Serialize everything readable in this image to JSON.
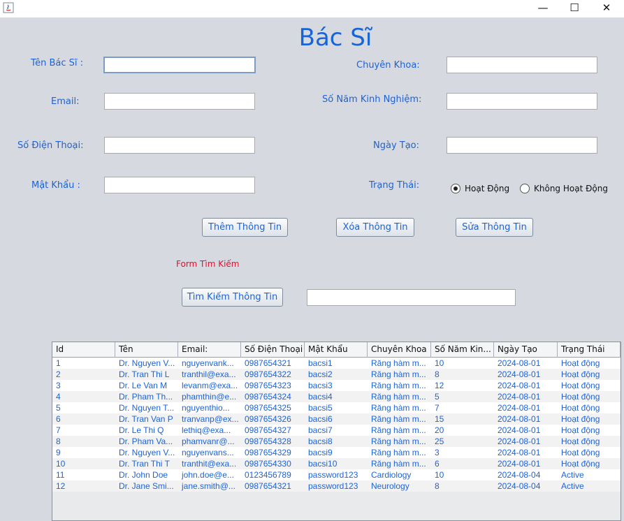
{
  "window": {
    "minimize": "—",
    "maximize": "☐",
    "close": "✕"
  },
  "heading": "Bác Sĩ",
  "labels": {
    "name": "Tên Bác Sĩ :",
    "email": "Email:",
    "phone": "Số Điện Thoại:",
    "password": "Mật Khẩu :",
    "specialty": "Chuyên Khoa:",
    "experience": "Số Năm Kinh Nghiệm:",
    "created": "Ngày Tạo:",
    "status": "Trạng Thái:"
  },
  "fields": {
    "name": "",
    "email": "",
    "phone": "",
    "password": "",
    "specialty": "",
    "experience": "",
    "created": "",
    "search": ""
  },
  "radios": {
    "active": "Hoạt Động",
    "inactive": "Không Hoạt Động",
    "selected": "active"
  },
  "buttons": {
    "add": "Thêm Thông Tin",
    "delete": "Xóa Thông Tin",
    "edit": "Sửa Thông Tin",
    "search": "Tìm Kiếm Thông Tin"
  },
  "search_form_label": "Form Tìm Kiếm",
  "table": {
    "headers": [
      "Id",
      "Tên",
      "Email:",
      "Số Điện Thoại",
      "Mật Khẩu",
      "Chuyên Khoa",
      "Số Năm Kin...",
      "Ngày Tạo",
      "Trạng Thái"
    ],
    "rows": [
      [
        "1",
        "Dr. Nguyen V...",
        "nguyenvank...",
        "0987654321",
        "bacsi1",
        "Răng hàm m...",
        "10",
        "2024-08-01",
        "Hoạt động"
      ],
      [
        "2",
        "Dr. Tran Thi L",
        "tranthil@exa...",
        "0987654322",
        "bacsi2",
        "Răng hàm m...",
        "8",
        "2024-08-01",
        "Hoạt động"
      ],
      [
        "3",
        "Dr. Le Van M",
        "levanm@exa...",
        "0987654323",
        "bacsi3",
        "Răng hàm m...",
        "12",
        "2024-08-01",
        "Hoạt động"
      ],
      [
        "4",
        "Dr. Pham Th...",
        "phamthin@e...",
        "0987654324",
        "bacsi4",
        "Răng hàm m...",
        "5",
        "2024-08-01",
        "Hoạt động"
      ],
      [
        "5",
        "Dr. Nguyen T...",
        "nguyenthio...",
        "0987654325",
        "bacsi5",
        "Răng hàm m...",
        "7",
        "2024-08-01",
        "Hoạt động"
      ],
      [
        "6",
        "Dr. Tran Van P",
        "tranvanp@ex...",
        "0987654326",
        "bacsi6",
        "Răng hàm m...",
        "15",
        "2024-08-01",
        "Hoạt động"
      ],
      [
        "7",
        "Dr. Le Thi Q",
        "lethiq@exa...",
        "0987654327",
        "bacsi7",
        "Răng hàm m...",
        "20",
        "2024-08-01",
        "Hoạt động"
      ],
      [
        "8",
        "Dr. Pham Va...",
        "phamvanr@...",
        "0987654328",
        "bacsi8",
        "Răng hàm m...",
        "25",
        "2024-08-01",
        "Hoạt động"
      ],
      [
        "9",
        "Dr. Nguyen V...",
        "nguyenvans...",
        "0987654329",
        "bacsi9",
        "Răng hàm m...",
        "3",
        "2024-08-01",
        "Hoạt động"
      ],
      [
        "10",
        "Dr. Tran Thi T",
        "tranthit@exa...",
        "0987654330",
        "bacsi10",
        "Răng hàm m...",
        "6",
        "2024-08-01",
        "Hoạt động"
      ],
      [
        "11",
        "Dr. John Doe",
        "john.doe@e...",
        "0123456789",
        "password123",
        "Cardiology",
        "10",
        "2024-08-04",
        "Active"
      ],
      [
        "12",
        "Dr. Jane Smi...",
        "jane.smith@...",
        "0987654321",
        "password123",
        "Neurology",
        "8",
        "2024-08-04",
        "Active"
      ]
    ]
  }
}
